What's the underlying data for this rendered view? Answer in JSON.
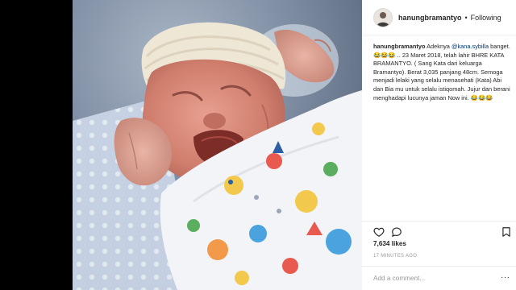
{
  "post": {
    "username": "hanungbramantyo",
    "separator": "•",
    "follow_status": "Following",
    "avatar_icon": "profile-photo"
  },
  "photo": {
    "description_icon": "newborn-baby-photo"
  },
  "caption": {
    "username": "hanungbramantyo",
    "text_before_mention": " Adeknya ",
    "mention": "@kana.sybilla",
    "text_after_mention": " banget. 😂😂😂 .. 23 Maret 2018, telah lahir BHRE KATA BRAMANTYO. ( Sang Kata dari keluarga Bramantyo). Berat 3,035 panjang 48cm. Semoga menjadi lelaki yang selalu menasehati (Kata) Abi dan Bia mu untuk selalu istiqomah. Jujur dan berani menghadapi lucunya jaman Now ini. 😂😂😂"
  },
  "actions": {
    "like_icon": "heart-icon",
    "comment_icon": "comment-bubble-icon",
    "save_icon": "bookmark-icon"
  },
  "stats": {
    "likes": "7,634 likes",
    "time": "17 MINUTES AGO"
  },
  "comment": {
    "placeholder": "Add a comment...",
    "more_label": "···"
  },
  "colors": {
    "backdrop": "#000000",
    "panel_bg": "#ffffff",
    "text": "#262626",
    "mention": "#003569",
    "muted": "#999999"
  }
}
